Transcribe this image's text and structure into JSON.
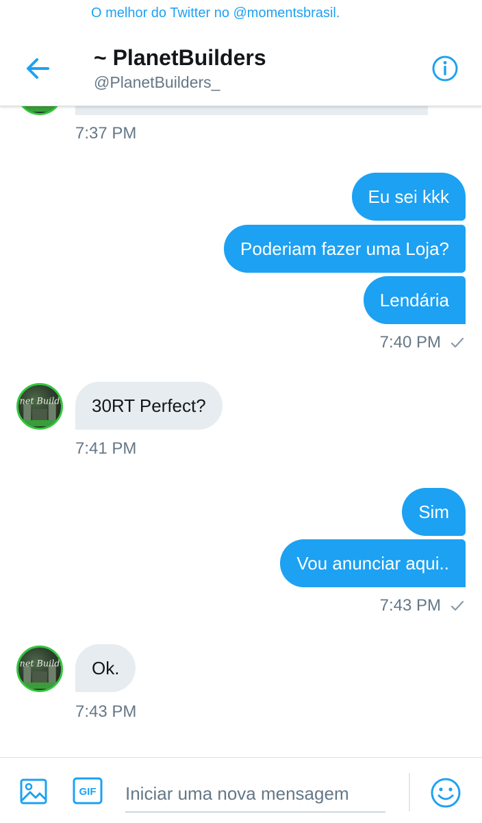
{
  "watermark": "O melhor do Twitter no @momentsbrasil.",
  "header": {
    "title": "~ PlanetBuilders",
    "handle": "@PlanetBuilders_"
  },
  "messages": [
    {
      "direction": "in",
      "time": "7:37 PM"
    },
    {
      "direction": "out",
      "texts": [
        "Eu sei kkk",
        "Poderiam fazer uma Loja?",
        "Lendária"
      ],
      "time": "7:40 PM",
      "status": "sent"
    },
    {
      "direction": "in",
      "texts": [
        "30RT Perfect?"
      ],
      "time": "7:41 PM"
    },
    {
      "direction": "out",
      "texts": [
        "Sim",
        "Vou anunciar aqui.."
      ],
      "time": "7:43 PM",
      "status": "sent"
    },
    {
      "direction": "in",
      "texts": [
        "Ok."
      ],
      "time": "7:43 PM"
    }
  ],
  "avatar_text": "Planet Builders",
  "composer": {
    "placeholder": "Iniciar uma nova mensagem",
    "gif_label": "GIF"
  },
  "icons": {
    "back": "arrow-left-icon",
    "info": "info-icon",
    "image": "image-icon",
    "gif": "gif-icon",
    "emoji": "smiley-icon",
    "check": "check-icon"
  },
  "colors": {
    "accent": "#1da1f2",
    "incoming_bubble": "#e6ecf0",
    "secondary_text": "#657786"
  }
}
